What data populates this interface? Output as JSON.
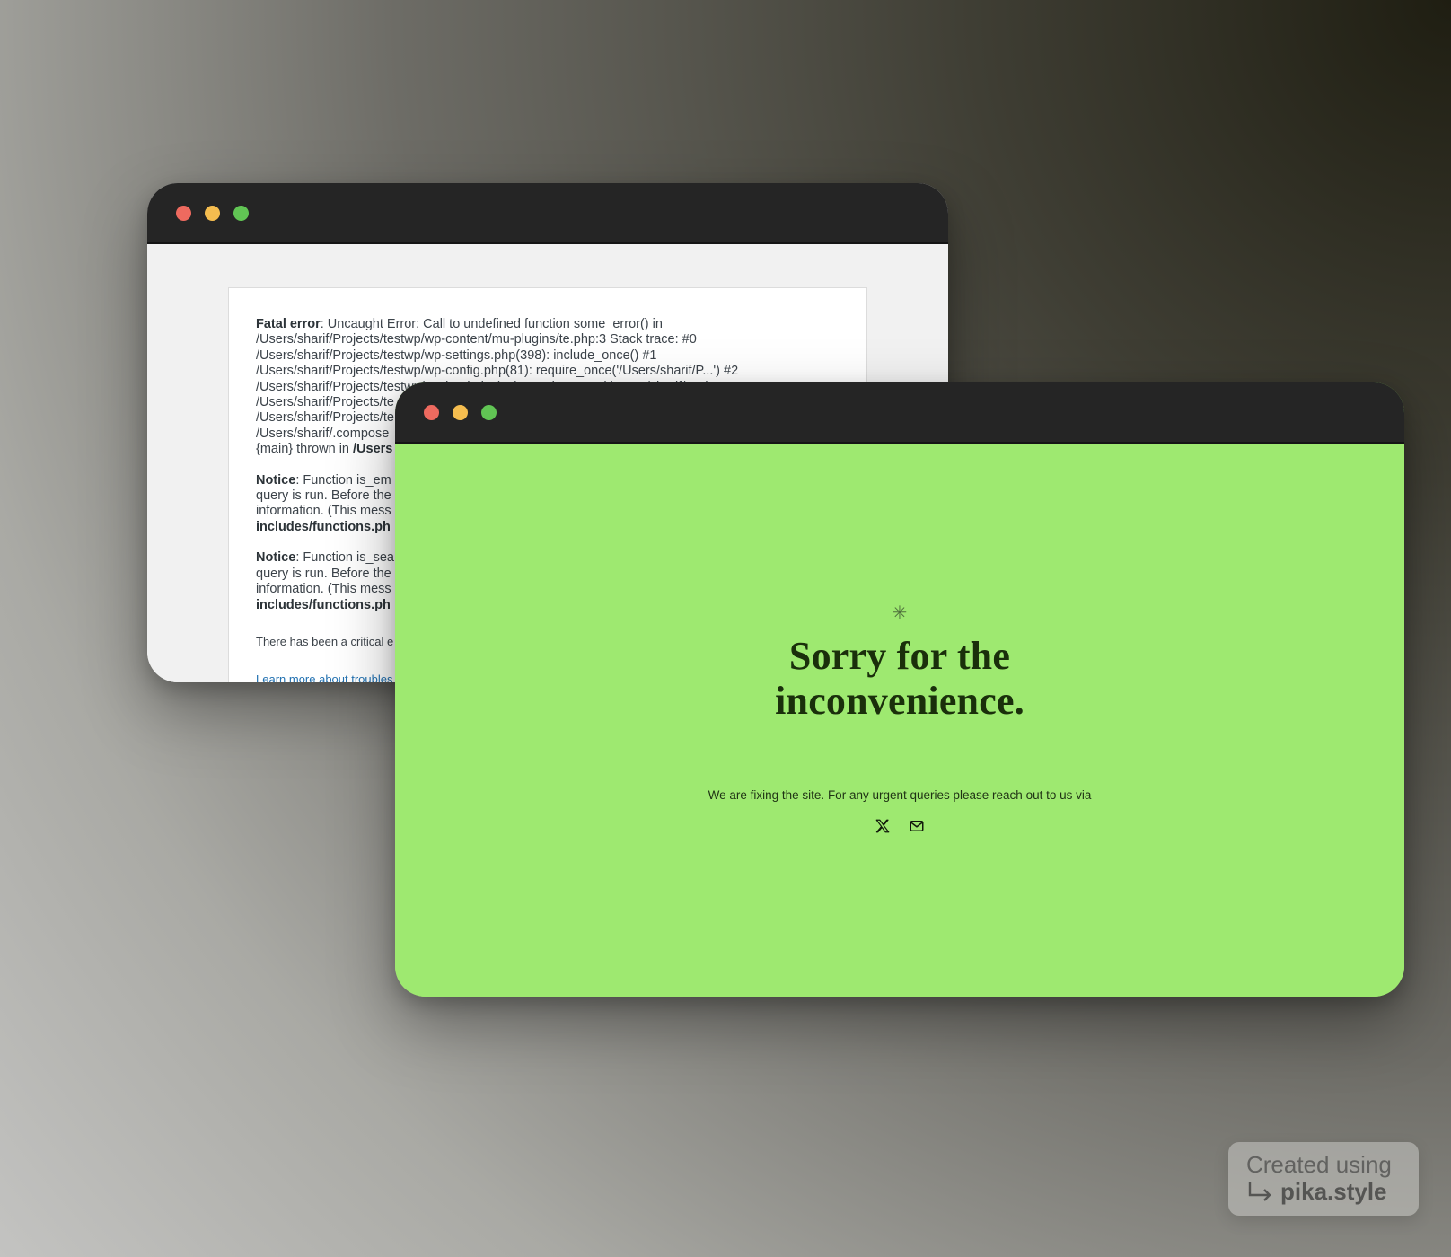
{
  "back_window": {
    "error_blocks": [
      {
        "lines": [
          {
            "label": "Fatal error",
            "text": ": Uncaught Error: Call to undefined function some_error() in"
          },
          {
            "label": "",
            "text": "/Users/sharif/Projects/testwp/wp-content/mu-plugins/te.php:3 Stack trace: #0"
          },
          {
            "label": "",
            "text": "/Users/sharif/Projects/testwp/wp-settings.php(398): include_once() #1"
          },
          {
            "label": "",
            "text": "/Users/sharif/Projects/testwp/wp-config.php(81): require_once('/Users/sharif/P...') #2"
          },
          {
            "label": "",
            "text": "/Users/sharif/Projects/testwp/wp-load.php(50): require_once('/Users/sharif/P...') #3"
          },
          {
            "label": "",
            "text": "/Users/sharif/Projects/te"
          },
          {
            "label": "",
            "text": "/Users/sharif/Projects/te"
          },
          {
            "label": "",
            "text": "/Users/sharif/.compose"
          },
          {
            "label": "",
            "text": "{main} thrown in ",
            "bold_tail": "/Users"
          }
        ]
      },
      {
        "lines": [
          {
            "label": "Notice",
            "text": ": Function is_em"
          },
          {
            "label": "",
            "text": "query is run. Before the"
          },
          {
            "label": "",
            "text": "information. (This mess"
          },
          {
            "label": "",
            "text": "",
            "bold_tail": "includes/functions.ph"
          }
        ]
      },
      {
        "lines": [
          {
            "label": "Notice",
            "text": ": Function is_sea"
          },
          {
            "label": "",
            "text": "query is run. Before the"
          },
          {
            "label": "",
            "text": "information. (This mess"
          },
          {
            "label": "",
            "text": "",
            "bold_tail": "includes/functions.ph"
          }
        ]
      }
    ],
    "critical_text": "There has been a critical e",
    "learn_more_link": "Learn more about troubles"
  },
  "front_window": {
    "asterisk": "✳",
    "headline_line1": "Sorry for the",
    "headline_line2": "inconvenience.",
    "subtext": "We are fixing the site. For any urgent queries please reach out to us via",
    "socials": [
      {
        "icon": "x-twitter-icon"
      },
      {
        "icon": "mail-icon"
      }
    ],
    "accent_color": "#9ee970"
  },
  "watermark": {
    "line1": "Created using",
    "line2": "pika.style"
  }
}
